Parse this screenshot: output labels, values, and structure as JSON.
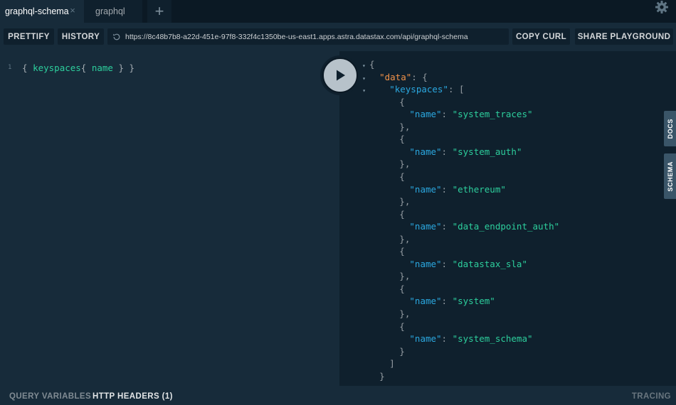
{
  "tabs": [
    {
      "label": "graphql-schema",
      "active": true
    },
    {
      "label": "graphql",
      "active": false
    }
  ],
  "tab_close_glyph": "×",
  "tab_add_glyph": "+",
  "toolbar": {
    "prettify_label": "PRETTIFY",
    "history_label": "HISTORY",
    "url": "https://8c48b7b8-a22d-451e-97f8-332f4c1350be-us-east1.apps.astra.datastax.com/api/graphql-schema",
    "copy_curl_label": "COPY CURL",
    "share_label": "SHARE PLAYGROUND"
  },
  "query": {
    "line_number": "1",
    "open": "{ ",
    "field": "keyspaces",
    "sub_open": "{ ",
    "sub_field": "name",
    "close": " } }"
  },
  "result": {
    "data_key": "\"data\"",
    "keyspaces_key": "\"keyspaces\"",
    "name_key": "\"name\"",
    "keyspace_names": [
      "system_traces",
      "system_auth",
      "ethereum",
      "data_endpoint_auth",
      "datastax_sla",
      "system",
      "system_schema"
    ]
  },
  "side_tabs": {
    "docs": "DOCS",
    "schema": "SCHEMA"
  },
  "footer": {
    "query_variables": "QUERY VARIABLES",
    "http_headers": "HTTP HEADERS (1)",
    "tracing": "TRACING"
  },
  "icons": {
    "settings": "gear-icon",
    "reload": "reload-icon",
    "run": "play-icon",
    "fold": "triangle-down-icon",
    "close": "close-icon",
    "add": "plus-icon"
  },
  "colors": {
    "key": "#2ba8e0",
    "data_key": "#f29249",
    "string": "#2dcf9d",
    "background": "#0f202d",
    "panel": "#172b3a"
  }
}
